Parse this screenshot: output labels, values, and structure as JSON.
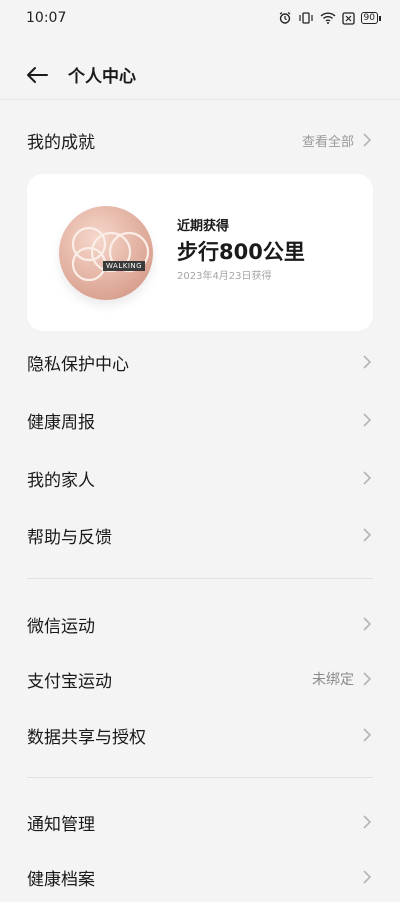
{
  "status_bar": {
    "time": "10:07",
    "battery": "90"
  },
  "header": {
    "title": "个人中心"
  },
  "achievements": {
    "label": "我的成就",
    "view_all": "查看全部",
    "card": {
      "kicker": "近期获得",
      "title": "步行800公里",
      "date": "2023年4月23日获得",
      "medal_text": "WALKING"
    }
  },
  "menu_group_1": [
    {
      "label": "隐私保护中心"
    },
    {
      "label": "健康周报"
    },
    {
      "label": "我的家人"
    },
    {
      "label": "帮助与反馈"
    }
  ],
  "menu_group_2": [
    {
      "label": "微信运动"
    },
    {
      "label": "支付宝运动",
      "value": "未绑定"
    },
    {
      "label": "数据共享与授权"
    }
  ],
  "menu_group_3": [
    {
      "label": "通知管理"
    },
    {
      "label": "健康档案"
    }
  ]
}
